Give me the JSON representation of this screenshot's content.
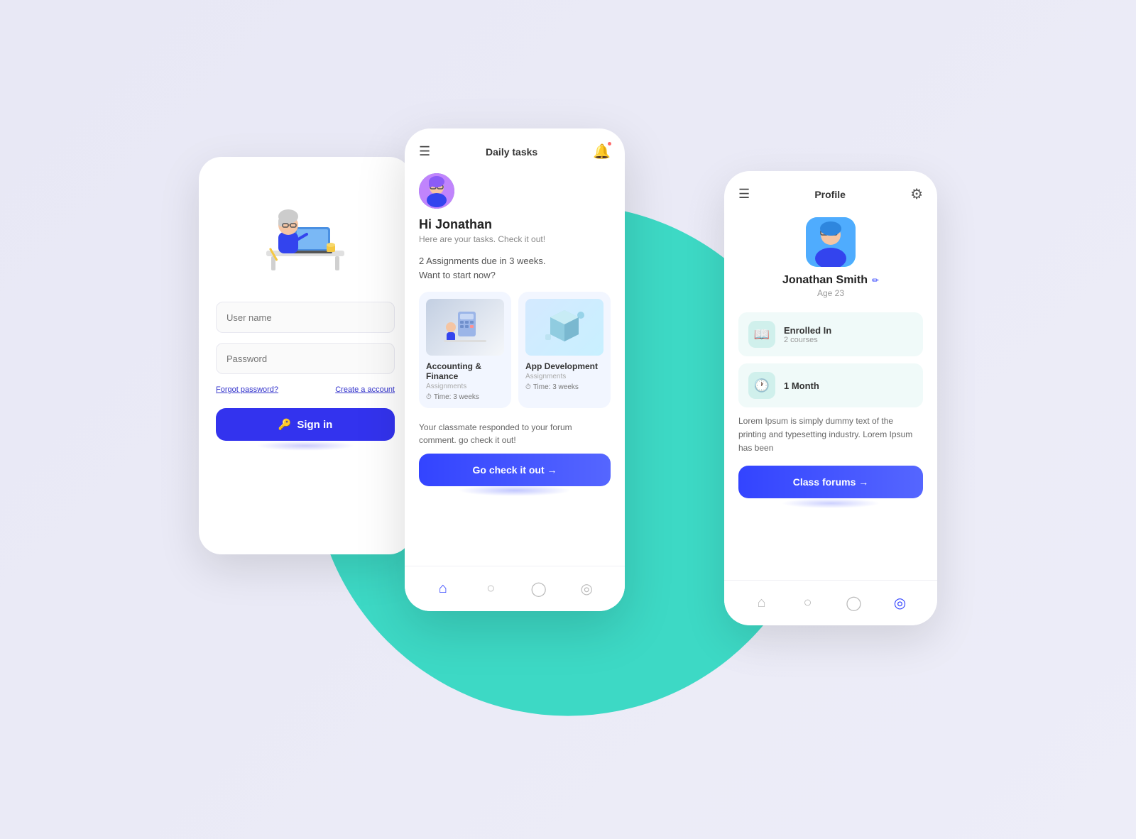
{
  "scene": {
    "teal_circle_color": "#3dd9c5"
  },
  "login_phone": {
    "username_placeholder": "User name",
    "password_placeholder": "Password",
    "forgot_password_label": "Forgot password?",
    "create_account_label": "Create a account",
    "sign_in_label": "Sign in"
  },
  "tasks_phone": {
    "header_title": "Daily tasks",
    "greeting_name": "Hi Jonathan",
    "greeting_sub": "Here are your tasks. Check it out!",
    "assignments_note_line1": "2 Assignments due in 3 weeks.",
    "assignments_note_line2": "Want to start now?",
    "courses": [
      {
        "title": "Accounting & Finance",
        "sub": "Assignments",
        "time": "Time: 3 weeks"
      },
      {
        "title": "App Development",
        "sub": "Assignments",
        "time": "Time: 3 weeks"
      }
    ],
    "forum_text": "Your classmate responded to your forum comment. go check it out!",
    "go_check_btn_label": "Go check it out →",
    "nav": [
      "home",
      "clock",
      "chat",
      "profile"
    ]
  },
  "profile_phone": {
    "header_title": "Profile",
    "user_name": "Jonathan Smith",
    "user_age": "Age 23",
    "enrolled_label": "Enrolled In",
    "enrolled_sub": "2 courses",
    "month_label": "1 Month",
    "bio": "Lorem Ipsum is simply dummy text of the printing and typesetting industry. Lorem Ipsum has been",
    "class_forums_btn_label": "Class forums →",
    "nav": [
      "home",
      "clock",
      "chat",
      "profile"
    ]
  }
}
